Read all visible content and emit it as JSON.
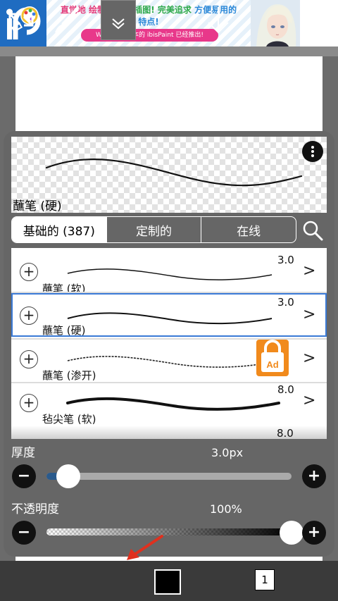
{
  "ad": {
    "line1_part1": "直觉地",
    "line1_part2": "绘制",
    "line1_part3": "高水准插图!",
    "line1_part4": "完美追求",
    "line1_part5": "方便易用的",
    "line2": "特点!",
    "pill": "Windows 版本的 ibisPaint 已经推出!"
  },
  "brush_panel": {
    "preview_name": "蘸笔 (硬)",
    "tabs": [
      {
        "label": "基础的 (387)"
      },
      {
        "label": "定制的"
      },
      {
        "label": "在线"
      }
    ],
    "brushes": [
      {
        "name": "蘸笔 (软)",
        "size": "3.0"
      },
      {
        "name": "蘸笔 (硬)",
        "size": "3.0"
      },
      {
        "name": "蘸笔 (渗开)",
        "size": ""
      },
      {
        "name": "毡尖笔 (软)",
        "size": "8.0"
      }
    ],
    "partial_size": "8.0",
    "ad_lock_label": "Ad",
    "thickness_label": "厚度",
    "thickness_value": "3.0px",
    "thickness_fraction": 0.09,
    "opacity_label": "不透明度",
    "opacity_value": "100%",
    "opacity_fraction": 1.0
  },
  "toolbar": {
    "layer_count": "1"
  },
  "colors": {
    "selection_border": "#3a7ad6",
    "ad_lock": "#f18a1c",
    "ad_pill": "#e8388a",
    "slider_fill": "#2a5a8c",
    "annotation_arrow": "#e0301e"
  },
  "icons": [
    "ibispaint-logo-icon",
    "more-vertical-icon",
    "search-icon",
    "plus-icon",
    "chevron-right-icon",
    "lock-icon",
    "minus-icon",
    "transform-tool-icon",
    "brush-icon",
    "chevron-down-icon",
    "arrow-down-icon",
    "layers-icon",
    "back-arrow-icon"
  ]
}
